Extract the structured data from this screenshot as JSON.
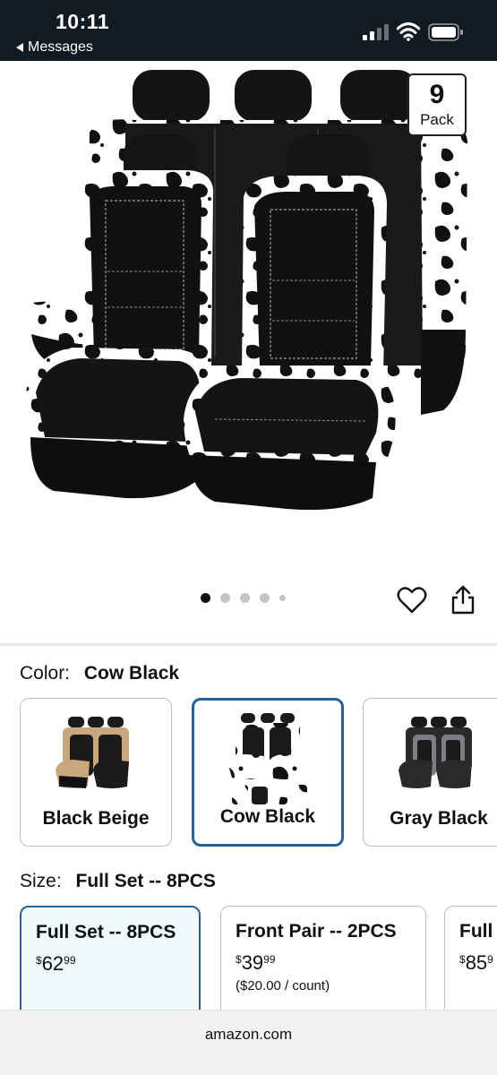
{
  "status_bar": {
    "time": "10:11",
    "back_label": "Messages",
    "icons": [
      "signal-icon",
      "wifi-icon",
      "battery-icon"
    ]
  },
  "product_image": {
    "badge_number": "9",
    "badge_label": "Pack",
    "carousel": {
      "total": 5,
      "active_index": 0
    }
  },
  "actions": {
    "icons": [
      "heart-icon",
      "share-icon"
    ]
  },
  "color": {
    "key": "Color:",
    "value": "Cow Black",
    "options": [
      {
        "label": "Black Beige",
        "selected": false,
        "accent": "#c9a77c"
      },
      {
        "label": "Cow Black",
        "selected": true,
        "accent": "#ffffff"
      },
      {
        "label": "Gray Black",
        "selected": false,
        "accent": "#7b7f85"
      }
    ]
  },
  "size": {
    "key": "Size:",
    "value": "Full Set -- 8PCS",
    "options": [
      {
        "name": "Full Set -- 8PCS",
        "currency": "$",
        "whole": "62",
        "cents": "99",
        "unit": "",
        "selected": true
      },
      {
        "name": "Front Pair -- 2PCS",
        "currency": "$",
        "whole": "39",
        "cents": "99",
        "unit": "($20.00 / count)",
        "selected": false
      },
      {
        "name": "Full",
        "currency": "$",
        "whole": "85",
        "cents": "9",
        "unit": "",
        "selected": false
      }
    ]
  },
  "browser": {
    "url": "amazon.com"
  },
  "colors": {
    "selected_border": "#2162a1",
    "selected_bg": "#eef9fc",
    "status_bg": "#121a22"
  }
}
